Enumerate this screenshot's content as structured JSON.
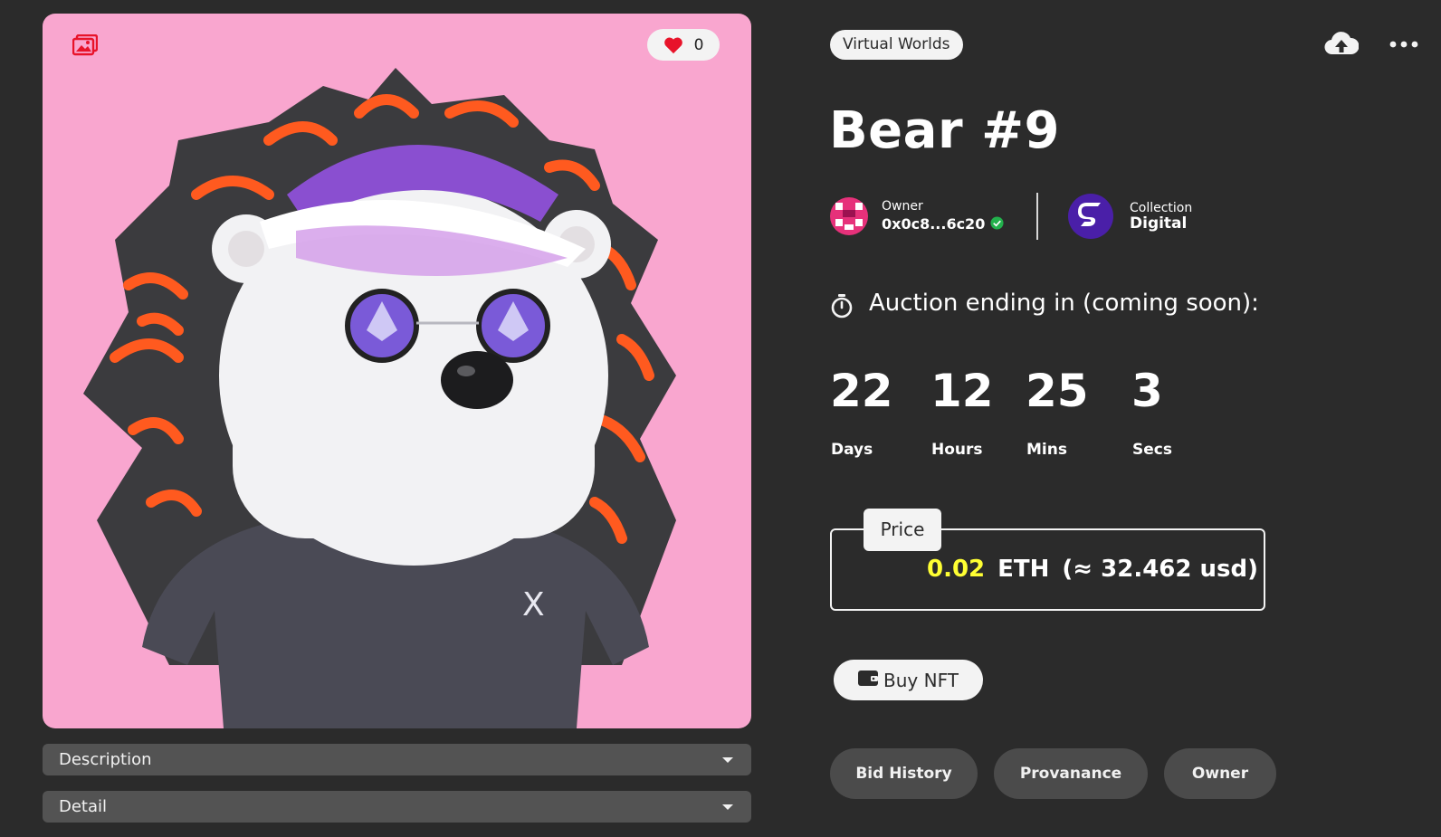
{
  "artwork": {
    "like_count": "0",
    "icons": {
      "media": "image-icon",
      "like": "heart-icon"
    },
    "background_color": "#f9a6cf"
  },
  "accordions": [
    {
      "label": "Description"
    },
    {
      "label": "Detail"
    }
  ],
  "header": {
    "category": "Virtual Worlds",
    "icons": {
      "upload": "cloud-upload-icon",
      "more": "more-dots-icon"
    }
  },
  "title": "Bear #9",
  "owner": {
    "label": "Owner",
    "address": "0x0c8...6c20",
    "verified": true
  },
  "collection": {
    "label": "Collection",
    "name": "Digital"
  },
  "auction": {
    "text": "Auction ending in (coming soon):",
    "countdown": [
      {
        "value": "22",
        "unit": "Days"
      },
      {
        "value": "12",
        "unit": "Hours"
      },
      {
        "value": "25",
        "unit": "Mins"
      },
      {
        "value": "3",
        "unit": "Secs"
      }
    ]
  },
  "price": {
    "label": "Price",
    "amount": "0.02",
    "currency": "ETH",
    "usd": "(≈ 32.462 usd)"
  },
  "buy_label": "Buy NFT",
  "tabs": [
    {
      "label": "Bid History"
    },
    {
      "label": "Provanance"
    },
    {
      "label": "Owner"
    }
  ],
  "colors": {
    "background": "#2b2b2b",
    "accent_price": "#ffff33",
    "verified": "#22b14c",
    "like_heart": "#e8132a"
  }
}
